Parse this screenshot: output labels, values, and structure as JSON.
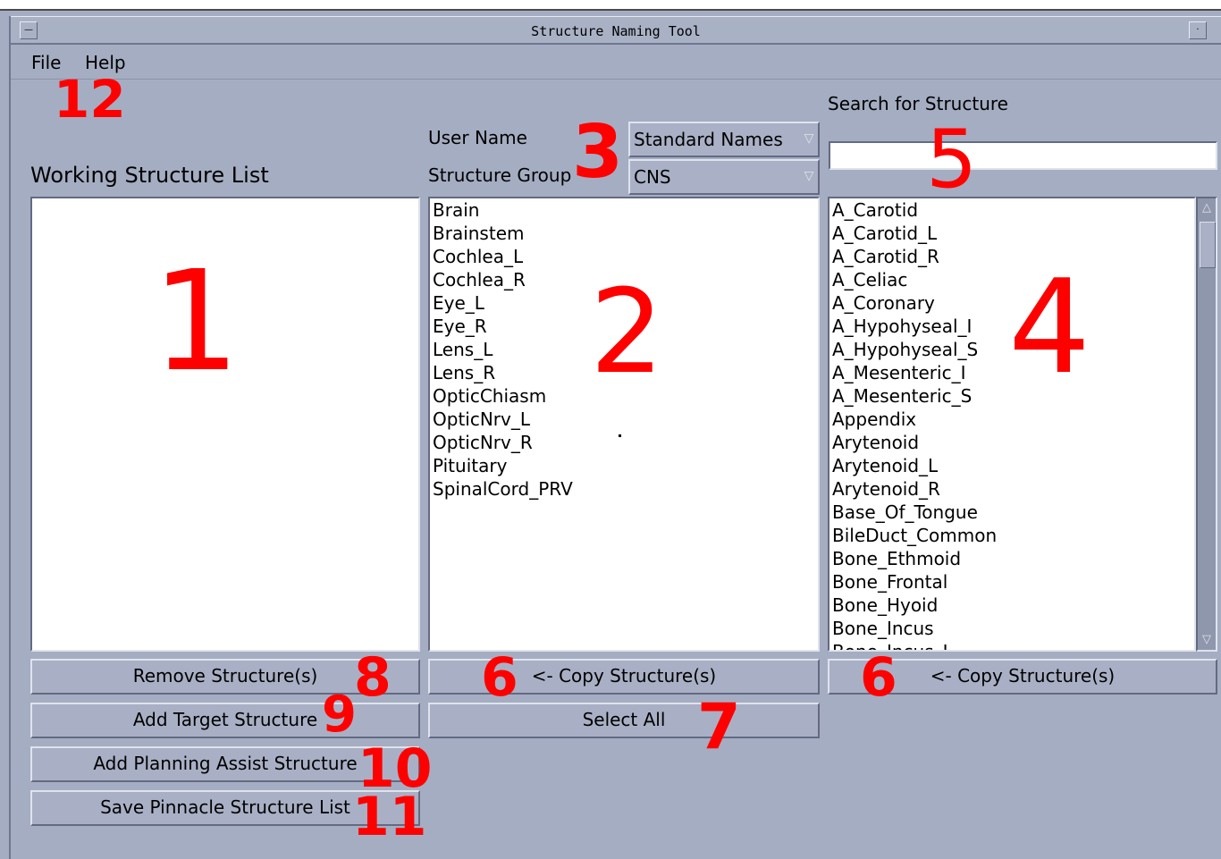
{
  "window": {
    "title": "Structure Naming Tool"
  },
  "menu": {
    "items": [
      "File",
      "Help"
    ]
  },
  "labels": {
    "working_list": "Working Structure List",
    "user_name": "User Name",
    "structure_group": "Structure Group",
    "search": "Search for Structure"
  },
  "user_name_select": {
    "value": "Standard Names"
  },
  "structure_group_select": {
    "value": "CNS"
  },
  "search_input": {
    "value": ""
  },
  "working_list": {
    "items": []
  },
  "group_list": {
    "items": [
      "Brain",
      "Brainstem",
      "Cochlea_L",
      "Cochlea_R",
      "Eye_L",
      "Eye_R",
      "Lens_L",
      "Lens_R",
      "OpticChiasm",
      "OpticNrv_L",
      "OpticNrv_R",
      "Pituitary",
      "SpinalCord_PRV"
    ]
  },
  "search_list": {
    "items": [
      "A_Carotid",
      "A_Carotid_L",
      "A_Carotid_R",
      "A_Celiac",
      "A_Coronary",
      "A_Hypohyseal_I",
      "A_Hypohyseal_S",
      "A_Mesenteric_I",
      "A_Mesenteric_S",
      "Appendix",
      "Arytenoid",
      "Arytenoid_L",
      "Arytenoid_R",
      "Base_Of_Tongue",
      "BileDuct_Common",
      "Bone_Ethmoid",
      "Bone_Frontal",
      "Bone_Hyoid",
      "Bone_Incus",
      "Bone_Incus_L"
    ]
  },
  "buttons": {
    "remove": "Remove Structure(s)",
    "add_target": "Add Target Structure",
    "add_planning": "Add Planning Assist Structure",
    "save_pinnacle": "Save Pinnacle Structure List",
    "copy_from_group": "<- Copy Structure(s)",
    "select_all": "Select All",
    "copy_from_search": "<- Copy Structure(s)"
  },
  "annotations": {
    "n1": "1",
    "n2": "2",
    "n3": "3",
    "n4": "4",
    "n5": "5",
    "n6a": "6",
    "n6b": "6",
    "n7": "7",
    "n8": "8",
    "n9": "9",
    "n10": "10",
    "n11": "11",
    "n12": "12"
  },
  "colors": {
    "background": "#a5adc2",
    "list_background": "#ffffff",
    "annotation": "#ff0000"
  }
}
